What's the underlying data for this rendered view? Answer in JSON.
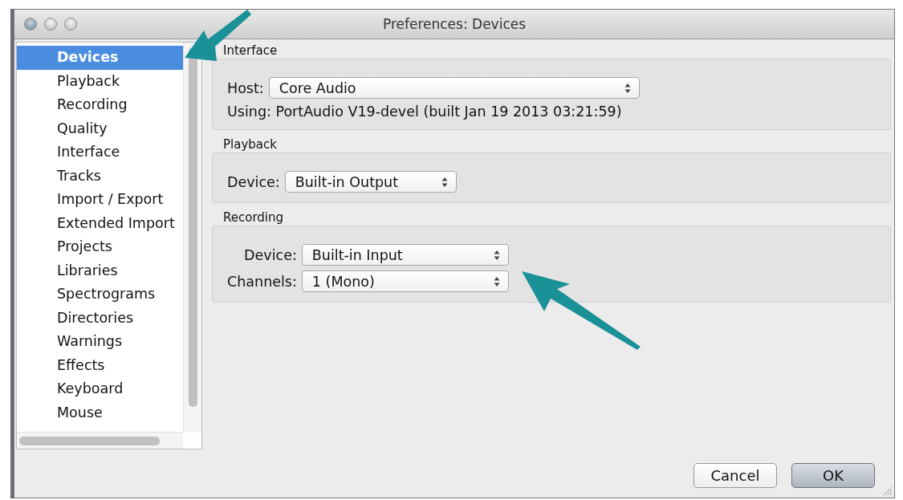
{
  "window": {
    "title": "Preferences: Devices"
  },
  "sidebar": {
    "items": [
      {
        "label": "Devices",
        "selected": true
      },
      {
        "label": "Playback",
        "selected": false
      },
      {
        "label": "Recording",
        "selected": false
      },
      {
        "label": "Quality",
        "selected": false
      },
      {
        "label": "Interface",
        "selected": false
      },
      {
        "label": "Tracks",
        "selected": false
      },
      {
        "label": "Import / Export",
        "selected": false
      },
      {
        "label": "Extended Import",
        "selected": false
      },
      {
        "label": "Projects",
        "selected": false
      },
      {
        "label": "Libraries",
        "selected": false
      },
      {
        "label": "Spectrograms",
        "selected": false
      },
      {
        "label": "Directories",
        "selected": false
      },
      {
        "label": "Warnings",
        "selected": false
      },
      {
        "label": "Effects",
        "selected": false
      },
      {
        "label": "Keyboard",
        "selected": false
      },
      {
        "label": "Mouse",
        "selected": false
      }
    ]
  },
  "groups": [
    {
      "title": "Interface",
      "rows": [
        {
          "kind": "select",
          "label": "Host:",
          "value": "Core Audio"
        },
        {
          "kind": "text",
          "text": "Using: PortAudio V19-devel (built Jan 19 2013 03:21:59)"
        }
      ]
    },
    {
      "title": "Playback",
      "rows": [
        {
          "kind": "select",
          "label": "Device:",
          "value": "Built-in Output"
        }
      ]
    },
    {
      "title": "Recording",
      "rows": [
        {
          "kind": "select",
          "label": "Device:",
          "value": "Built-in Input"
        },
        {
          "kind": "select",
          "label": "Channels:",
          "value": "1 (Mono)"
        }
      ]
    }
  ],
  "buttons": [
    {
      "label": "Cancel",
      "default": false
    },
    {
      "label": "OK",
      "default": true
    }
  ]
}
